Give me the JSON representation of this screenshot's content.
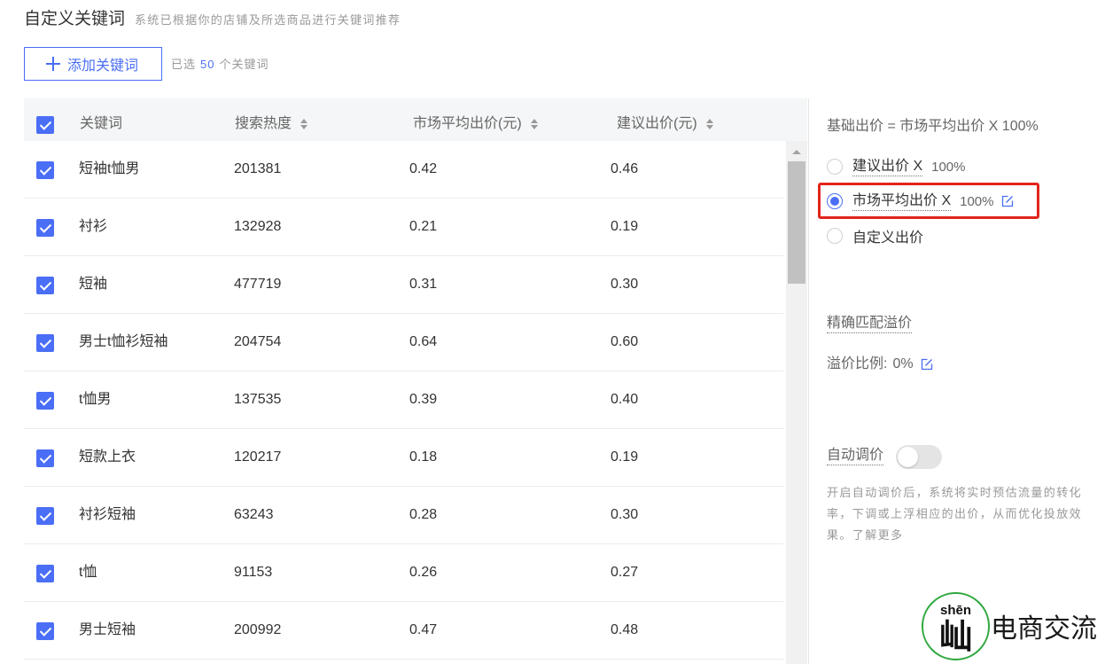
{
  "header": {
    "title": "自定义关键词",
    "subtitle": "系统已根据你的店铺及所选商品进行关键词推荐"
  },
  "toolbar": {
    "add_label": "添加关键词",
    "selected_prefix": "已选",
    "selected_count": 50,
    "selected_suffix": "个关键词"
  },
  "table": {
    "select_all": true,
    "columns": {
      "keyword": "关键词",
      "search_heat": "搜索热度",
      "market_avg_bid": "市场平均出价(元)",
      "suggested_bid": "建议出价(元)"
    },
    "rows": [
      {
        "checked": true,
        "keyword": "短袖t恤男",
        "search_heat": "201381",
        "market_avg_bid": "0.42",
        "suggested_bid": "0.46"
      },
      {
        "checked": true,
        "keyword": "衬衫",
        "search_heat": "132928",
        "market_avg_bid": "0.21",
        "suggested_bid": "0.19"
      },
      {
        "checked": true,
        "keyword": "短袖",
        "search_heat": "477719",
        "market_avg_bid": "0.31",
        "suggested_bid": "0.30"
      },
      {
        "checked": true,
        "keyword": "男士t恤衫短袖",
        "search_heat": "204754",
        "market_avg_bid": "0.64",
        "suggested_bid": "0.60"
      },
      {
        "checked": true,
        "keyword": "t恤男",
        "search_heat": "137535",
        "market_avg_bid": "0.39",
        "suggested_bid": "0.40"
      },
      {
        "checked": true,
        "keyword": "短款上衣",
        "search_heat": "120217",
        "market_avg_bid": "0.18",
        "suggested_bid": "0.19"
      },
      {
        "checked": true,
        "keyword": "衬衫短袖",
        "search_heat": "63243",
        "market_avg_bid": "0.28",
        "suggested_bid": "0.30"
      },
      {
        "checked": true,
        "keyword": "t恤",
        "search_heat": "91153",
        "market_avg_bid": "0.26",
        "suggested_bid": "0.27"
      },
      {
        "checked": true,
        "keyword": "男士短袖",
        "search_heat": "200992",
        "market_avg_bid": "0.47",
        "suggested_bid": "0.48"
      }
    ]
  },
  "bid_panel": {
    "formula": "基础出价 = 市场平均出价 X 100%",
    "options": [
      {
        "label": "建议出价 X",
        "value": "100%",
        "checked": false
      },
      {
        "label": "市场平均出价 X",
        "value": "100%",
        "checked": true
      },
      {
        "label": "自定义出价",
        "checked": false
      }
    ],
    "premium": {
      "title": "精确匹配溢价",
      "ratio_label": "溢价比例:",
      "ratio_value": "0%"
    },
    "auto_adjust": {
      "label": "自动调价",
      "enabled": false,
      "description_lines": [
        "开启自动调价后，系统将实时预估流量的转化",
        "率，下调或上浮相应的出价，从而优化投放效",
        "果。"
      ],
      "learn_more": "了解更多"
    }
  },
  "watermark": {
    "pinyin": "shēn",
    "glyph": "屾",
    "text": "电商交流"
  },
  "colors": {
    "accent": "#4a6ef5",
    "highlight": "#e1251b",
    "logo_green": "#2fa83f"
  },
  "icons": {
    "add": "plus-icon",
    "sort": "sort-icon",
    "edit": "edit-icon",
    "scroll_up": "triangle-up-icon"
  }
}
